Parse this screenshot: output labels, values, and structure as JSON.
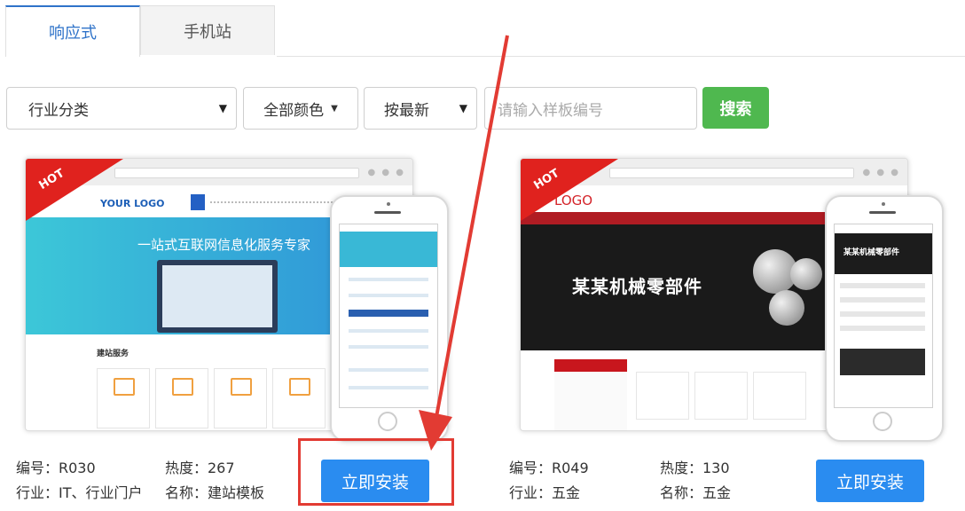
{
  "tabs": [
    {
      "label": "响应式",
      "active": true
    },
    {
      "label": "手机站",
      "active": false
    }
  ],
  "filters": {
    "industry": "行业分类",
    "color": "全部颜色",
    "sort": "按最新",
    "search_placeholder": "请输入样板编号",
    "search_button": "搜索"
  },
  "cards": [
    {
      "hot": "HOT",
      "preview": {
        "logo": "YOUR LOGO",
        "banner_title": "一站式互联网信息化服务专家",
        "section_title": "建站服务"
      },
      "code_label": "编号：R030",
      "heat_label": "热度：267",
      "industry_label": "行业：IT、行业门户",
      "name_label": "名称：建站模板",
      "install_label": "立即安装"
    },
    {
      "hot": "HOT",
      "preview": {
        "logo": "LOGO",
        "banner_title": "某某机械零部件",
        "mobile_title": "某某机械零部件"
      },
      "code_label": "编号：R049",
      "heat_label": "热度：130",
      "industry_label": "行业：五金",
      "name_label": "名称：五金",
      "install_label": "立即安装"
    }
  ],
  "colors": {
    "accent": "#2f73c9",
    "install": "#2a8cf0",
    "search": "#4fb84f",
    "hot": "#e0221e",
    "annotation": "#e23b33"
  }
}
